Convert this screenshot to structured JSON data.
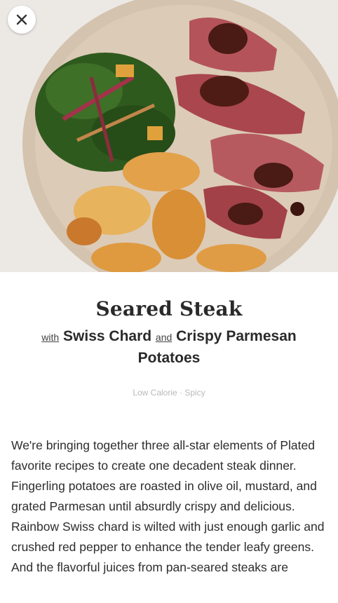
{
  "recipe": {
    "title": "Seared Steak",
    "with_word": "with",
    "side_one": "Swiss Chard",
    "and_word": "and",
    "side_two": "Crispy Parmesan Potatoes",
    "tags": "Low Calorie · Spicy",
    "description": "We're bringing together three all-star elements of Plated favorite recipes to create one decadent steak dinner. Fingerling potatoes are roasted in olive oil, mustard, and grated Parmesan until absurdly crispy and delicious. Rainbow Swiss chard is wilted with just enough garlic and crushed red pepper to enhance the tender leafy greens. And the flavorful juices from pan-seared steaks are"
  },
  "icons": {
    "close": "close-icon"
  },
  "colors": {
    "plate": "#d9c8b4",
    "steak": "#b4545a",
    "greens": "#2f5a1e",
    "potato": "#e3a14a"
  }
}
